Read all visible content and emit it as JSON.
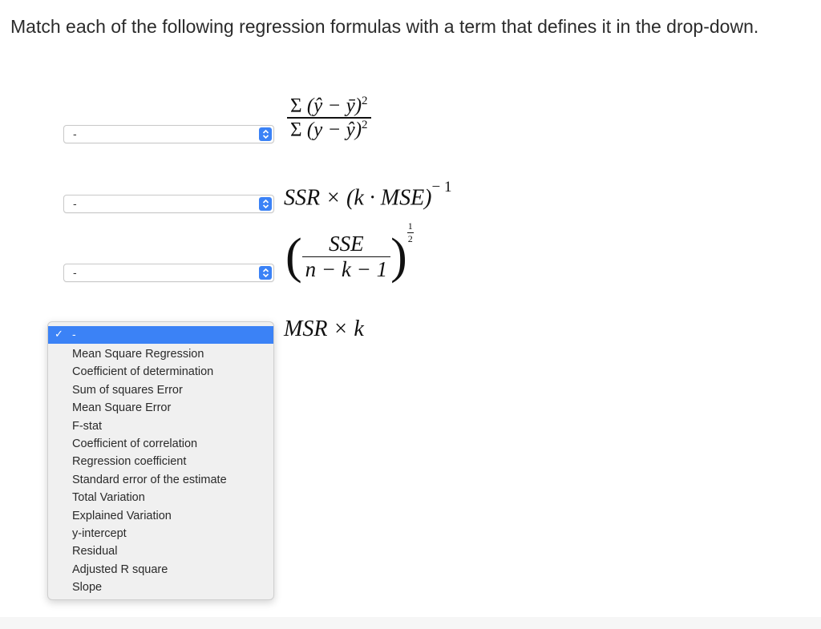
{
  "question": {
    "prompt": "Match each of the following regression formulas with a term that defines it in the drop-down."
  },
  "rows": [
    {
      "select_value": "-",
      "formula": {
        "num_sum": "Σ",
        "num_expr": "(ŷ − ȳ)",
        "num_exp": "2",
        "den_sum": "Σ",
        "den_expr": "(y − ŷ)",
        "den_exp": "2"
      }
    },
    {
      "select_value": "-",
      "formula": {
        "text": "SSR × (k · MSE)",
        "exp": "− 1"
      }
    },
    {
      "select_value": "-",
      "formula": {
        "num": "SSE",
        "den": "n − k − 1",
        "exp_num": "1",
        "exp_den": "2"
      }
    },
    {
      "formula": {
        "text": "MSR × k"
      }
    }
  ],
  "dropdown": {
    "selected_label": "-",
    "check_glyph": "✓",
    "options": [
      "Mean Square Regression",
      "Coefficient of determination",
      "Sum of squares Error",
      "Mean Square Error",
      "F-stat",
      "Coefficient of correlation",
      "Regression coefficient",
      "Standard error of the estimate",
      "Total Variation",
      "Explained Variation",
      "y-intercept",
      "Residual",
      "Adjusted R square",
      "Slope"
    ]
  },
  "colors": {
    "accent": "#3b82f6",
    "menu_background": "#f0f0f0"
  },
  "icons": {
    "stepper": "chevron-up-down-icon",
    "checkmark": "check-icon"
  }
}
